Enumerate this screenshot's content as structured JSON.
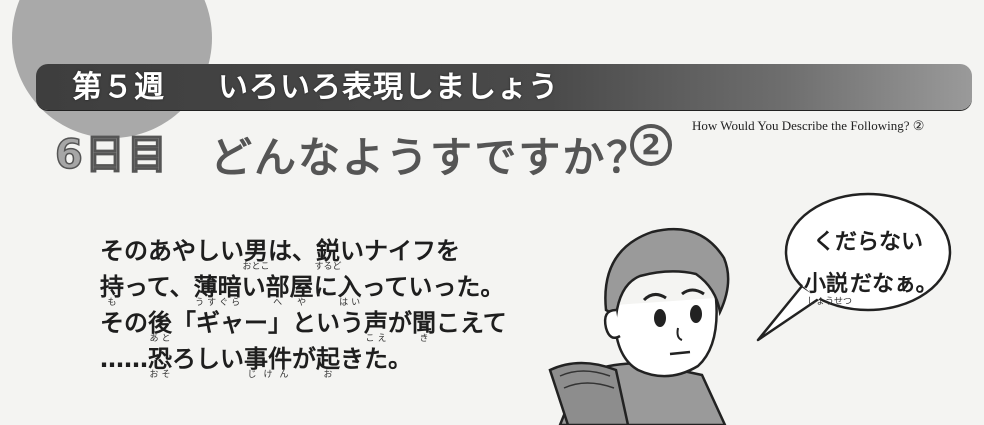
{
  "header": {
    "week": "第５週",
    "title": "いろいろ表現しましょう"
  },
  "lesson": {
    "day": "6日目",
    "title": "どんなようすですか？",
    "number": "2",
    "english": "How Would You Describe the Following? ②"
  },
  "paragraph": {
    "lines": [
      [
        {
          "t": "そのあやしい"
        },
        {
          "t": "男",
          "r": "おとこ"
        },
        {
          "t": "は、"
        },
        {
          "t": "鋭",
          "r": "するど"
        },
        {
          "t": "いナイフを"
        }
      ],
      [
        {
          "t": "持",
          "r": "も"
        },
        {
          "t": "って、"
        },
        {
          "t": "薄暗",
          "r": "うすぐら"
        },
        {
          "t": "い"
        },
        {
          "t": "部屋",
          "r": "へや"
        },
        {
          "t": "に"
        },
        {
          "t": "入",
          "r": "はい"
        },
        {
          "t": "っていった。"
        }
      ],
      [
        {
          "t": "その"
        },
        {
          "t": "後",
          "r": "あと"
        },
        {
          "t": "「ギャー」という"
        },
        {
          "t": "声",
          "r": "こえ"
        },
        {
          "t": "が"
        },
        {
          "t": "聞",
          "r": "き"
        },
        {
          "t": "こえて"
        }
      ],
      [
        {
          "t": "……"
        },
        {
          "t": "恐",
          "r": "おそ"
        },
        {
          "t": "ろしい"
        },
        {
          "t": "事件",
          "r": "じけん"
        },
        {
          "t": "が"
        },
        {
          "t": "起",
          "r": "お"
        },
        {
          "t": "きた。"
        }
      ]
    ]
  },
  "speech": {
    "line1": "くだらない",
    "word": "小説",
    "reading": "しょうせつ",
    "rest": "だなぁ。"
  }
}
